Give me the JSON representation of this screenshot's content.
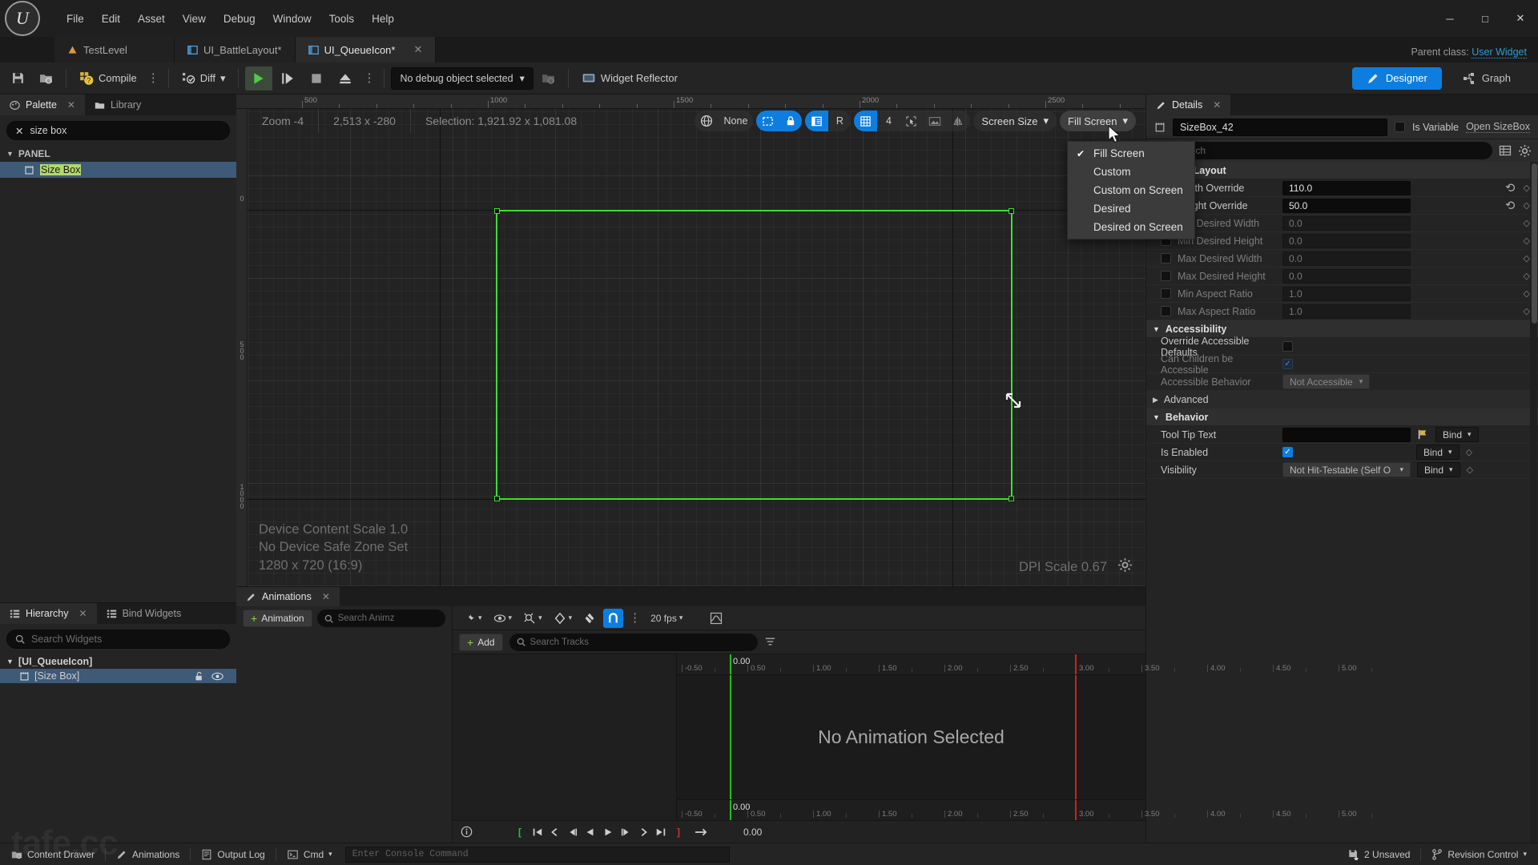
{
  "app": {
    "logo_glyph": "U",
    "parent_class_label": "Parent class:",
    "parent_class_value": "User Widget",
    "watermark": "tafe.cc"
  },
  "menu": {
    "items": [
      "File",
      "Edit",
      "Asset",
      "View",
      "Debug",
      "Window",
      "Tools",
      "Help"
    ]
  },
  "window_controls": {
    "minimize": "─",
    "maximize": "□",
    "close": "✕"
  },
  "asset_tabs": [
    {
      "label": "TestLevel",
      "icon": "level-icon",
      "active": false,
      "closable": false
    },
    {
      "label": "UI_BattleLayout*",
      "icon": "widget-icon",
      "active": false,
      "closable": false
    },
    {
      "label": "UI_QueueIcon*",
      "icon": "widget-icon",
      "active": true,
      "closable": true
    }
  ],
  "toolbar": {
    "save_label": "",
    "browse_label": "",
    "compile_label": "Compile",
    "diff_label": "Diff",
    "debug_object_label": "No debug object selected",
    "widget_reflector_label": "Widget Reflector",
    "designer_label": "Designer",
    "graph_label": "Graph"
  },
  "palette": {
    "tabs": [
      {
        "label": "Palette",
        "active": true,
        "closable": true
      },
      {
        "label": "Library",
        "active": false,
        "closable": false
      }
    ],
    "search_value": "size box",
    "category": "PANEL",
    "items": [
      {
        "label": "Size Box",
        "highlighted": true
      }
    ]
  },
  "hierarchy": {
    "tabs": [
      {
        "label": "Hierarchy",
        "active": true,
        "closable": true
      },
      {
        "label": "Bind Widgets",
        "active": false,
        "closable": false
      }
    ],
    "search_placeholder": "Search Widgets",
    "root": "[UI_QueueIcon]",
    "child": "[Size Box]"
  },
  "viewport": {
    "zoom_label": "Zoom -4",
    "coords_label": "2,513 x -280",
    "selection_label": "Selection: 1,921.92 x 1,081.08",
    "fill_mode_none": "None",
    "grid_snap_value": "4",
    "screen_size_label": "Screen Size",
    "fill_screen_label": "Fill Screen",
    "overlay_line1": "Device Content Scale 1.0",
    "overlay_line2": "No Device Safe Zone Set",
    "overlay_line3": "1280 x 720 (16:9)",
    "dpi_label": "DPI Scale 0.67",
    "ruler_h_ticks": [
      "500",
      "1000",
      "1500",
      "2000",
      "2500"
    ],
    "ruler_v_ticks": [
      "0",
      "500",
      "1000"
    ]
  },
  "screen_size_menu": {
    "open": true,
    "items": [
      {
        "label": "Fill Screen",
        "checked": true
      },
      {
        "label": "Custom",
        "checked": false
      },
      {
        "label": "Custom on Screen",
        "checked": false
      },
      {
        "label": "Desired",
        "checked": false
      },
      {
        "label": "Desired on Screen",
        "checked": false
      }
    ]
  },
  "details": {
    "title": "Details",
    "widget_name": "SizeBox_42",
    "is_variable_label": "Is Variable",
    "is_variable_checked": false,
    "open_sizebox_label": "Open SizeBox",
    "search_placeholder": "Search",
    "sections": [
      {
        "name": "Child Layout",
        "expanded": true,
        "rows": [
          {
            "label": "Width Override",
            "checkbox": true,
            "checked": true,
            "value": "110.0",
            "dim": false,
            "reset": true,
            "diamond": true
          },
          {
            "label": "Height Override",
            "checkbox": true,
            "checked": true,
            "value": "50.0",
            "dim": false,
            "reset": true,
            "diamond": true
          },
          {
            "label": "Min Desired Width",
            "checkbox": true,
            "checked": false,
            "value": "0.0",
            "dim": true,
            "reset": false,
            "diamond": true
          },
          {
            "label": "Min Desired Height",
            "checkbox": true,
            "checked": false,
            "value": "0.0",
            "dim": true,
            "reset": false,
            "diamond": true
          },
          {
            "label": "Max Desired Width",
            "checkbox": true,
            "checked": false,
            "value": "0.0",
            "dim": true,
            "reset": false,
            "diamond": true
          },
          {
            "label": "Max Desired Height",
            "checkbox": true,
            "checked": false,
            "value": "0.0",
            "dim": true,
            "reset": false,
            "diamond": true
          },
          {
            "label": "Min Aspect Ratio",
            "checkbox": true,
            "checked": false,
            "value": "1.0",
            "dim": true,
            "reset": false,
            "diamond": true
          },
          {
            "label": "Max Aspect Ratio",
            "checkbox": true,
            "checked": false,
            "value": "1.0",
            "dim": true,
            "reset": false,
            "diamond": true
          }
        ]
      }
    ],
    "accessibility": {
      "title": "Accessibility",
      "override_label": "Override Accessible Defaults",
      "override_checked": false,
      "children_label": "Can Children be Accessible",
      "children_checked": true,
      "behavior_label": "Accessible Behavior",
      "behavior_value": "Not Accessible"
    },
    "advanced_label": "Advanced",
    "behavior": {
      "title": "Behavior",
      "tooltip_label": "Tool Tip Text",
      "tooltip_value": "",
      "is_enabled_label": "Is Enabled",
      "is_enabled_checked": true,
      "visibility_label": "Visibility",
      "visibility_value": "Not Hit-Testable (Self O",
      "bind_label": "Bind"
    }
  },
  "animations": {
    "tab_label": "Animations",
    "add_animation_label": "Animation",
    "search_anim_placeholder": "Search Animz",
    "add_track_label": "Add",
    "search_tracks_placeholder": "Search Tracks",
    "fps_label": "20 fps",
    "empty_message": "No Animation Selected",
    "playhead_time": "0.00",
    "current_time": "0.00",
    "ruler_ticks": [
      "-0.50",
      "0.50",
      "1.00",
      "1.50",
      "2.00",
      "2.50",
      "3.00",
      "3.50",
      "4.00",
      "4.50",
      "5.00"
    ]
  },
  "statusbar": {
    "content_drawer": "Content Drawer",
    "animations": "Animations",
    "output_log": "Output Log",
    "cmd_label": "Cmd",
    "console_placeholder": "Enter Console Command",
    "unsaved_label": "2 Unsaved",
    "revision_label": "Revision Control"
  },
  "colors": {
    "accent_blue": "#0d7ee0",
    "selection_green": "#3ae02e",
    "highlight_green": "#b2d96a",
    "tree_select": "#3d5a77"
  }
}
